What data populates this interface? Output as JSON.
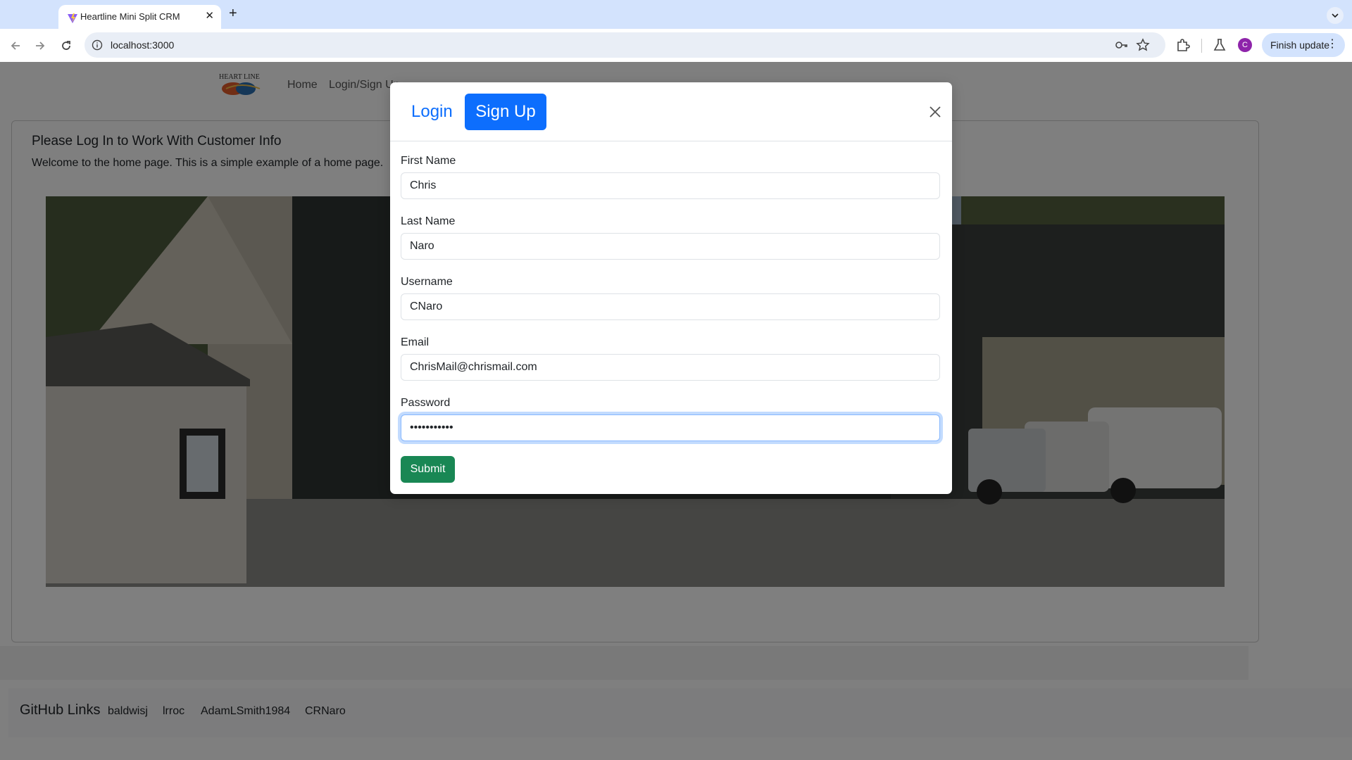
{
  "browser": {
    "tab_title": "Heartline Mini Split CRM",
    "url": "localhost:3000",
    "profile_initial": "C",
    "finish_update_label": "Finish update",
    "icons": [
      "back-arrow-icon",
      "forward-arrow-icon",
      "reload-icon",
      "site-info-icon",
      "password-key-icon",
      "bookmark-star-icon",
      "extensions-icon",
      "labs-flask-icon",
      "more-vert-icon"
    ]
  },
  "site_nav": {
    "logo_text": "HEART LINE",
    "links": [
      "Home",
      "Login/Sign Up"
    ]
  },
  "content": {
    "title": "Please Log In to Work With Customer Info",
    "text": "Welcome to the home page. This is a simple example of a home page."
  },
  "modal": {
    "tab_login": "Login",
    "tab_signup": "Sign Up",
    "active_tab": "Sign Up",
    "fields": [
      {
        "label": "First Name",
        "value": "Chris",
        "type": "text"
      },
      {
        "label": "Last Name",
        "value": "Naro",
        "type": "text"
      },
      {
        "label": "Username",
        "value": "CNaro",
        "type": "text"
      },
      {
        "label": "Email",
        "value": "ChrisMail@chrismail.com",
        "type": "email"
      },
      {
        "label": "Password",
        "value": "•••••••••••",
        "type": "password"
      }
    ],
    "submit_label": "Submit"
  },
  "footer": {
    "title": "GitHub Links",
    "links": [
      "baldwisj",
      "lrroc",
      "AdamLSmith1984",
      "CRNaro"
    ]
  },
  "colors": {
    "primary": "#0d6efd",
    "success": "#198754",
    "tabstrip": "#d3e3fd"
  }
}
